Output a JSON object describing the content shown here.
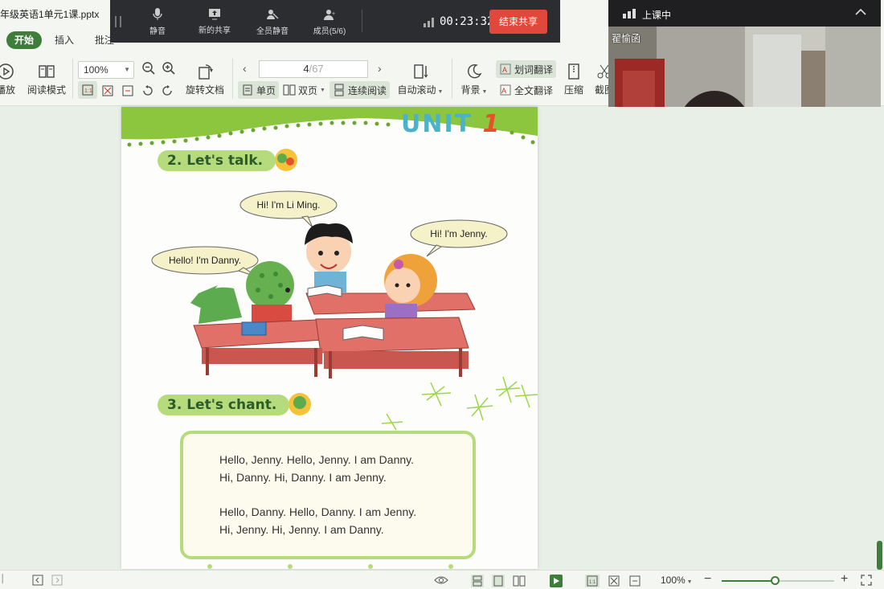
{
  "window": {
    "doc_title": "年级英语1单元1课.pptx"
  },
  "tabs": [
    {
      "label": "开始",
      "active": true
    },
    {
      "label": "插入",
      "active": false
    },
    {
      "label": "批注",
      "active": false
    }
  ],
  "toolbar": {
    "play_label": "播放",
    "read_mode_label": "阅读模式",
    "zoom_value": "100%",
    "rotate_label": "旋转文档",
    "page_current": "4",
    "page_total": "/67",
    "single_label": "单页",
    "double_label": "双页",
    "continuous_label": "连续阅读",
    "autoscroll_label": "自动滚动",
    "background_label": "背景",
    "word_translate_label": "划词翻译",
    "full_translate_label": "全文翻译",
    "compress_label": "压缩",
    "screenshot_label": "截图"
  },
  "meeting": {
    "mute_label": "静音",
    "new_share_label": "新的共享",
    "mute_all_label": "全员静音",
    "members_label": "成员(5/6)",
    "timer": "00:23:32",
    "end_share_label": "结束共享",
    "accent": "#e0483b"
  },
  "video": {
    "status": "上课中",
    "participant_name": "翟愉函"
  },
  "document": {
    "unit_word": "UNIT",
    "unit_num": "1",
    "talk_heading": "2. Let's talk.",
    "chant_heading": "3. Let's chant.",
    "bubble_li_ming": "Hi! I'm Li Ming.",
    "bubble_jenny": "Hi! I'm Jenny.",
    "bubble_danny": "Hello! I'm Danny.",
    "chant_lines": [
      "Hello, Jenny. Hello, Jenny. I am Danny.",
      "Hi, Danny. Hi, Danny. I am Jenny.",
      "Hello, Danny. Hello, Danny. I am Jenny.",
      "Hi, Jenny. Hi, Jenny. I am Danny."
    ]
  },
  "statusbar": {
    "zoom_value": "100%"
  },
  "colors": {
    "accent_green": "#3f7d3a",
    "pill_green": "#b5db7c"
  }
}
